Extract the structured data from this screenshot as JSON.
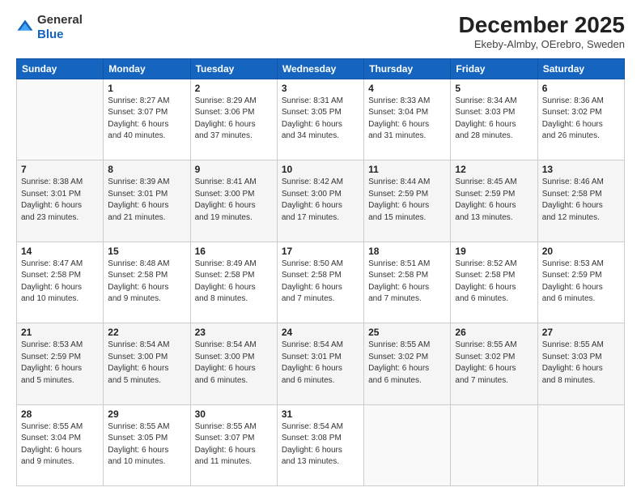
{
  "logo": {
    "line1": "General",
    "line2": "Blue"
  },
  "header": {
    "title": "December 2025",
    "location": "Ekeby-Almby, OErebro, Sweden"
  },
  "weekdays": [
    "Sunday",
    "Monday",
    "Tuesday",
    "Wednesday",
    "Thursday",
    "Friday",
    "Saturday"
  ],
  "weeks": [
    [
      {
        "day": "",
        "info": ""
      },
      {
        "day": "1",
        "info": "Sunrise: 8:27 AM\nSunset: 3:07 PM\nDaylight: 6 hours\nand 40 minutes."
      },
      {
        "day": "2",
        "info": "Sunrise: 8:29 AM\nSunset: 3:06 PM\nDaylight: 6 hours\nand 37 minutes."
      },
      {
        "day": "3",
        "info": "Sunrise: 8:31 AM\nSunset: 3:05 PM\nDaylight: 6 hours\nand 34 minutes."
      },
      {
        "day": "4",
        "info": "Sunrise: 8:33 AM\nSunset: 3:04 PM\nDaylight: 6 hours\nand 31 minutes."
      },
      {
        "day": "5",
        "info": "Sunrise: 8:34 AM\nSunset: 3:03 PM\nDaylight: 6 hours\nand 28 minutes."
      },
      {
        "day": "6",
        "info": "Sunrise: 8:36 AM\nSunset: 3:02 PM\nDaylight: 6 hours\nand 26 minutes."
      }
    ],
    [
      {
        "day": "7",
        "info": "Sunrise: 8:38 AM\nSunset: 3:01 PM\nDaylight: 6 hours\nand 23 minutes."
      },
      {
        "day": "8",
        "info": "Sunrise: 8:39 AM\nSunset: 3:01 PM\nDaylight: 6 hours\nand 21 minutes."
      },
      {
        "day": "9",
        "info": "Sunrise: 8:41 AM\nSunset: 3:00 PM\nDaylight: 6 hours\nand 19 minutes."
      },
      {
        "day": "10",
        "info": "Sunrise: 8:42 AM\nSunset: 3:00 PM\nDaylight: 6 hours\nand 17 minutes."
      },
      {
        "day": "11",
        "info": "Sunrise: 8:44 AM\nSunset: 2:59 PM\nDaylight: 6 hours\nand 15 minutes."
      },
      {
        "day": "12",
        "info": "Sunrise: 8:45 AM\nSunset: 2:59 PM\nDaylight: 6 hours\nand 13 minutes."
      },
      {
        "day": "13",
        "info": "Sunrise: 8:46 AM\nSunset: 2:58 PM\nDaylight: 6 hours\nand 12 minutes."
      }
    ],
    [
      {
        "day": "14",
        "info": "Sunrise: 8:47 AM\nSunset: 2:58 PM\nDaylight: 6 hours\nand 10 minutes."
      },
      {
        "day": "15",
        "info": "Sunrise: 8:48 AM\nSunset: 2:58 PM\nDaylight: 6 hours\nand 9 minutes."
      },
      {
        "day": "16",
        "info": "Sunrise: 8:49 AM\nSunset: 2:58 PM\nDaylight: 6 hours\nand 8 minutes."
      },
      {
        "day": "17",
        "info": "Sunrise: 8:50 AM\nSunset: 2:58 PM\nDaylight: 6 hours\nand 7 minutes."
      },
      {
        "day": "18",
        "info": "Sunrise: 8:51 AM\nSunset: 2:58 PM\nDaylight: 6 hours\nand 7 minutes."
      },
      {
        "day": "19",
        "info": "Sunrise: 8:52 AM\nSunset: 2:58 PM\nDaylight: 6 hours\nand 6 minutes."
      },
      {
        "day": "20",
        "info": "Sunrise: 8:53 AM\nSunset: 2:59 PM\nDaylight: 6 hours\nand 6 minutes."
      }
    ],
    [
      {
        "day": "21",
        "info": "Sunrise: 8:53 AM\nSunset: 2:59 PM\nDaylight: 6 hours\nand 5 minutes."
      },
      {
        "day": "22",
        "info": "Sunrise: 8:54 AM\nSunset: 3:00 PM\nDaylight: 6 hours\nand 5 minutes."
      },
      {
        "day": "23",
        "info": "Sunrise: 8:54 AM\nSunset: 3:00 PM\nDaylight: 6 hours\nand 6 minutes."
      },
      {
        "day": "24",
        "info": "Sunrise: 8:54 AM\nSunset: 3:01 PM\nDaylight: 6 hours\nand 6 minutes."
      },
      {
        "day": "25",
        "info": "Sunrise: 8:55 AM\nSunset: 3:02 PM\nDaylight: 6 hours\nand 6 minutes."
      },
      {
        "day": "26",
        "info": "Sunrise: 8:55 AM\nSunset: 3:02 PM\nDaylight: 6 hours\nand 7 minutes."
      },
      {
        "day": "27",
        "info": "Sunrise: 8:55 AM\nSunset: 3:03 PM\nDaylight: 6 hours\nand 8 minutes."
      }
    ],
    [
      {
        "day": "28",
        "info": "Sunrise: 8:55 AM\nSunset: 3:04 PM\nDaylight: 6 hours\nand 9 minutes."
      },
      {
        "day": "29",
        "info": "Sunrise: 8:55 AM\nSunset: 3:05 PM\nDaylight: 6 hours\nand 10 minutes."
      },
      {
        "day": "30",
        "info": "Sunrise: 8:55 AM\nSunset: 3:07 PM\nDaylight: 6 hours\nand 11 minutes."
      },
      {
        "day": "31",
        "info": "Sunrise: 8:54 AM\nSunset: 3:08 PM\nDaylight: 6 hours\nand 13 minutes."
      },
      {
        "day": "",
        "info": ""
      },
      {
        "day": "",
        "info": ""
      },
      {
        "day": "",
        "info": ""
      }
    ]
  ]
}
